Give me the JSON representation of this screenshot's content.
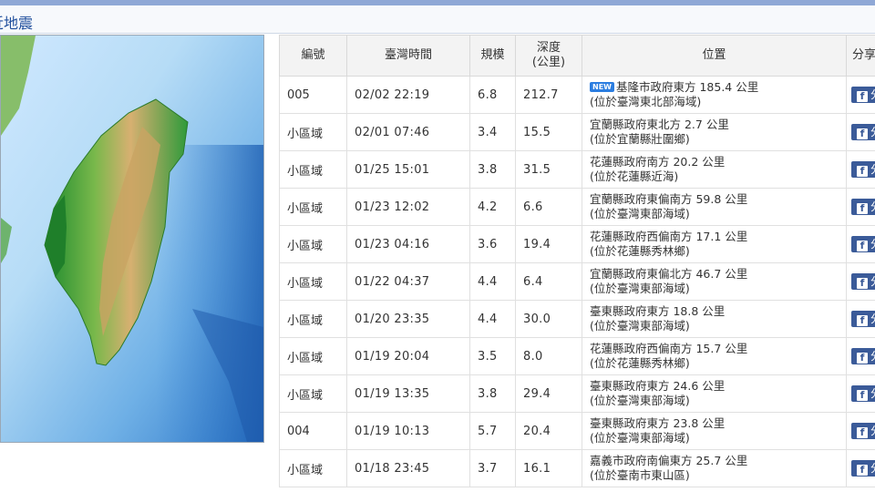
{
  "section": {
    "title": "近地震"
  },
  "table": {
    "headers": {
      "id": "編號",
      "time": "臺灣時間",
      "mag": "規模",
      "depth_line1": "深度",
      "depth_line2": "(公里)",
      "location": "位置",
      "share": "分享"
    },
    "new_badge": "NEW",
    "share_label": "分享",
    "rows": [
      {
        "id": "005",
        "time": "02/02 22:19",
        "mag": "6.8",
        "depth": "212.7",
        "loc1": "基隆市政府東方 185.4 公里",
        "loc2": "(位於臺灣東北部海域)",
        "is_new": true
      },
      {
        "id": "小區域",
        "time": "02/01 07:46",
        "mag": "3.4",
        "depth": "15.5",
        "loc1": "宜蘭縣政府東北方 2.7 公里",
        "loc2": "(位於宜蘭縣壯圍鄉)"
      },
      {
        "id": "小區域",
        "time": "01/25 15:01",
        "mag": "3.8",
        "depth": "31.5",
        "loc1": "花蓮縣政府南方 20.2 公里",
        "loc2": "(位於花蓮縣近海)"
      },
      {
        "id": "小區域",
        "time": "01/23 12:02",
        "mag": "4.2",
        "depth": "6.6",
        "loc1": "宜蘭縣政府東偏南方 59.8 公里",
        "loc2": "(位於臺灣東部海域)"
      },
      {
        "id": "小區域",
        "time": "01/23 04:16",
        "mag": "3.6",
        "depth": "19.4",
        "loc1": "花蓮縣政府西偏南方 17.1 公里",
        "loc2": "(位於花蓮縣秀林鄉)"
      },
      {
        "id": "小區域",
        "time": "01/22 04:37",
        "mag": "4.4",
        "depth": "6.4",
        "loc1": "宜蘭縣政府東偏北方 46.7 公里",
        "loc2": "(位於臺灣東部海域)"
      },
      {
        "id": "小區域",
        "time": "01/20 23:35",
        "mag": "4.4",
        "depth": "30.0",
        "loc1": "臺東縣政府東方 18.8 公里",
        "loc2": "(位於臺灣東部海域)"
      },
      {
        "id": "小區域",
        "time": "01/19 20:04",
        "mag": "3.5",
        "depth": "8.0",
        "loc1": "花蓮縣政府西偏南方 15.7 公里",
        "loc2": "(位於花蓮縣秀林鄉)"
      },
      {
        "id": "小區域",
        "time": "01/19 13:35",
        "mag": "3.8",
        "depth": "29.4",
        "loc1": "臺東縣政府東方 24.6 公里",
        "loc2": "(位於臺灣東部海域)"
      },
      {
        "id": "004",
        "time": "01/19 10:13",
        "mag": "5.7",
        "depth": "20.4",
        "loc1": "臺東縣政府東方 23.8 公里",
        "loc2": "(位於臺灣東部海域)"
      },
      {
        "id": "小區域",
        "time": "01/18 23:45",
        "mag": "3.7",
        "depth": "16.1",
        "loc1": "嘉義市政府南偏東方 25.7 公里",
        "loc2": "(位於臺南市東山區)"
      }
    ]
  },
  "colors": {
    "title_text": "#1f4e9c",
    "share_button": "#3b5b99",
    "new_badge": "#2b7de0"
  }
}
